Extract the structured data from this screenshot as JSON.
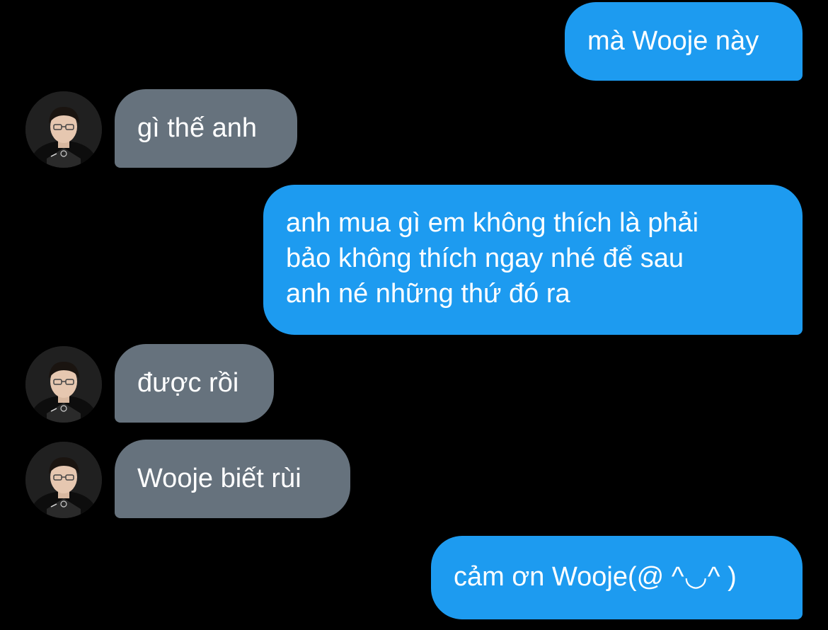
{
  "theme": {
    "background": "#000000",
    "sent_bubble_color": "#1d9bf0",
    "received_bubble_color": "#66727d",
    "text_color": "#ffffff"
  },
  "messages": [
    {
      "direction": "sent",
      "text": "mà Wooje này"
    },
    {
      "direction": "received",
      "avatar": "profile-photo",
      "text": "gì thế anh"
    },
    {
      "direction": "sent",
      "lines": [
        "anh mua gì em không thích là phải",
        "bảo không thích ngay nhé để sau",
        "anh né những thứ đó ra"
      ]
    },
    {
      "direction": "received",
      "avatar": "profile-photo",
      "text": "được rồi"
    },
    {
      "direction": "received",
      "avatar": "profile-photo",
      "text": "Wooje biết rùi"
    },
    {
      "direction": "sent",
      "text": "cảm ơn Wooje(@ ^◡^ )"
    }
  ]
}
